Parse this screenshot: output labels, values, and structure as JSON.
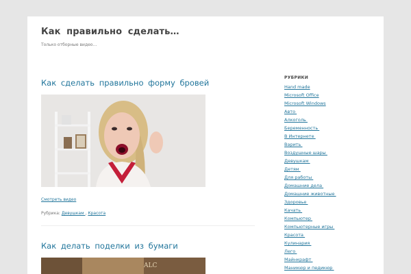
{
  "site": {
    "title": "Как правильно сделать…",
    "description": "Только отборные видео…"
  },
  "posts": [
    {
      "title": "Как сделать правильно форму бровей",
      "watch_link": "Смотреть видео ",
      "meta_label": "Рубрика: ",
      "categories": [
        "Девушкам ",
        "Красота "
      ]
    },
    {
      "title": "Как делать поделки из бумаги"
    }
  ],
  "sidebar": {
    "widget_title": "РУБРИКИ",
    "categories": [
      "Hand made",
      "Microsoft Office",
      "Microsoft Windows",
      "Авто ",
      "Алкоголь ",
      "Беременность ",
      "В Интернете ",
      "Варить ",
      "Воздушные шары ",
      "Девушкам ",
      "Детям ",
      "Для работы ",
      "Домашние дела ",
      "Домашние животные ",
      "Здоровье ",
      "Качать ",
      "Компьютер ",
      "Компьютерные игры ",
      "Красота ",
      "Кулинария ",
      "Лего ",
      "Майнкрафт ",
      "Маникюр и педикюр "
    ]
  },
  "colors": {
    "link": "#21759b",
    "background": "#e6e6e6",
    "page": "#ffffff"
  }
}
